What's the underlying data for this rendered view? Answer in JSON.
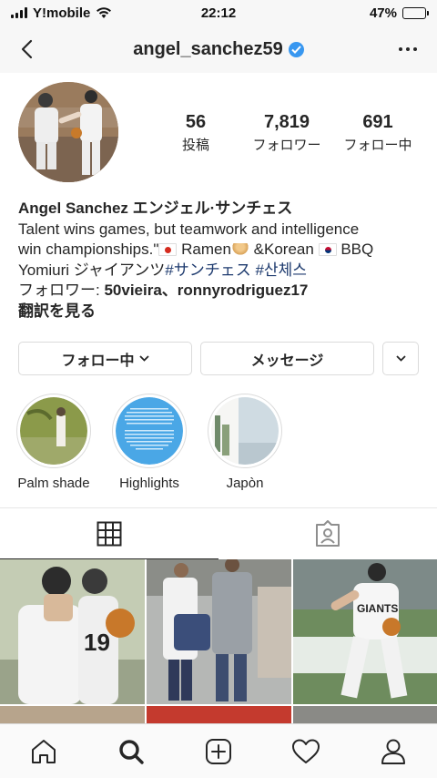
{
  "status_bar": {
    "carrier": "Y!mobile",
    "time": "22:12",
    "battery_percent": "47%",
    "battery_level": 0.47
  },
  "nav": {
    "username": "angel_sanchez59",
    "verified": true
  },
  "stats": {
    "posts_count": "56",
    "posts_label": "投稿",
    "followers_count": "7,819",
    "followers_label": "フォロワー",
    "following_count": "691",
    "following_label": "フォロー中"
  },
  "bio": {
    "name": "Angel Sanchez エンジェル·サンチェス",
    "line1": "Talent wins games, but teamwork and intelligence",
    "line2_a": "win championships.\"",
    "line2_b": "Ramen",
    "line2_c": "&Korean",
    "line2_d": "BBQ",
    "line3_a": "Yomiuri  ジャイアンツ",
    "hashtag1": "#サンチェス",
    "hashtag2": "#산체스",
    "followed_by_prefix": "フォロワー: ",
    "followed_by_names": "50vieira、ronnyrodriguez17",
    "translate": "翻訳を見る"
  },
  "buttons": {
    "following": "フォロー中",
    "message": "メッセージ"
  },
  "highlights": [
    {
      "label": "Palm shade"
    },
    {
      "label": "Highlights"
    },
    {
      "label": "Japòn"
    }
  ],
  "icons": {
    "back": "chevron-left-icon",
    "more": "ellipsis-icon",
    "grid": "grid-icon",
    "tagged": "tagged-icon",
    "home": "home-icon",
    "search": "search-icon",
    "new_post": "plus-square-icon",
    "activity": "heart-icon",
    "profile": "person-icon"
  },
  "colors": {
    "verified_blue": "#3897f0",
    "hashtag": "#1d3a6e",
    "border": "#dbdbdb"
  }
}
